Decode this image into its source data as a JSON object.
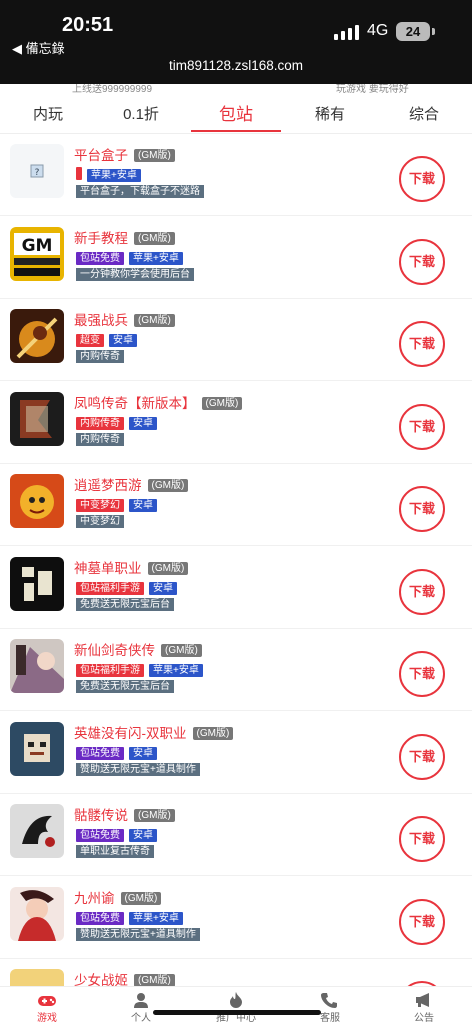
{
  "status": {
    "time": "20:51",
    "back": "◀ 備忘錄",
    "network": "4G",
    "battery": "24"
  },
  "browser": {
    "url": "tim891128.zsl168.com"
  },
  "ghost": {
    "left": "上线送999999999",
    "right": "玩游戏 要玩得好"
  },
  "tabs": [
    {
      "label": "内玩"
    },
    {
      "label": "0.1折"
    },
    {
      "label": "包站"
    },
    {
      "label": "稀有"
    },
    {
      "label": "综合"
    }
  ],
  "download_label": "下载",
  "colors": {
    "accent": "#e8343d",
    "tag_red": "#e8343d",
    "tag_blue": "#2c55c9",
    "tag_purple": "#6a2ac4",
    "tag_dark": "#5b6f80"
  },
  "games": [
    {
      "name": "平台盒子",
      "gm": "(GM版)",
      "tags": [
        {
          "text": "",
          "color": "red"
        },
        {
          "text": "苹果+安卓",
          "color": "blue"
        }
      ],
      "desc": "平台盒子，下载盒子不迷路",
      "icon": "question-box-icon"
    },
    {
      "name": "新手教程",
      "gm": "(GM版)",
      "tags": [
        {
          "text": "包站免费",
          "color": "purple"
        },
        {
          "text": "苹果+安卓",
          "color": "blue"
        }
      ],
      "desc": "一分钟教你学会使用后台",
      "icon": "gm-tutorial-icon"
    },
    {
      "name": "最强战兵",
      "gm": "(GM版)",
      "tags": [
        {
          "text": "超变",
          "color": "red"
        },
        {
          "text": "安卓",
          "color": "blue"
        }
      ],
      "desc": "内购传奇",
      "icon": "warrior-icon"
    },
    {
      "name": "凤鸣传奇【新版本】",
      "gm": "(GM版)",
      "tags": [
        {
          "text": "内购传奇",
          "color": "red"
        },
        {
          "text": "安卓",
          "color": "blue"
        }
      ],
      "desc": "内购传奇",
      "icon": "dragon-slayer-icon"
    },
    {
      "name": "逍遥梦西游",
      "gm": "(GM版)",
      "tags": [
        {
          "text": "中变梦幻",
          "color": "red"
        },
        {
          "text": "安卓",
          "color": "blue"
        }
      ],
      "desc": "中变梦幻",
      "icon": "journey-west-icon"
    },
    {
      "name": "神墓单职业",
      "gm": "(GM版)",
      "tags": [
        {
          "text": "包站福利手游",
          "color": "red"
        },
        {
          "text": "安卓",
          "color": "blue"
        }
      ],
      "desc": "免费送无限元宝后台",
      "icon": "shenmu-icon"
    },
    {
      "name": "新仙剑奇侠传",
      "gm": "(GM版)",
      "tags": [
        {
          "text": "包站福利手游",
          "color": "red"
        },
        {
          "text": "苹果+安卓",
          "color": "blue"
        }
      ],
      "desc": "免费送无限元宝后台",
      "icon": "xianjian-icon"
    },
    {
      "name": "英雄没有闪-双职业",
      "gm": "(GM版)",
      "tags": [
        {
          "text": "包站免费",
          "color": "purple"
        },
        {
          "text": "安卓",
          "color": "blue"
        }
      ],
      "desc": "赞助送无限元宝+道具制作",
      "icon": "hero-icon"
    },
    {
      "name": "骷髅传说",
      "gm": "(GM版)",
      "tags": [
        {
          "text": "包站免费",
          "color": "purple"
        },
        {
          "text": "安卓",
          "color": "blue"
        }
      ],
      "desc": "单职业复古传奇",
      "icon": "skull-dragon-icon"
    },
    {
      "name": "九州谕",
      "gm": "(GM版)",
      "tags": [
        {
          "text": "包站免费",
          "color": "purple"
        },
        {
          "text": "苹果+安卓",
          "color": "blue"
        }
      ],
      "desc": "赞助送无限元宝+道具制作",
      "icon": "jiuzhou-icon"
    },
    {
      "name": "少女战姬",
      "gm": "(GM版)",
      "tags": [],
      "desc": "",
      "icon": "girl-warrior-icon"
    }
  ],
  "bottom_nav": [
    {
      "label": "游戏",
      "icon": "gamepad-icon"
    },
    {
      "label": "个人",
      "icon": "person-icon"
    },
    {
      "label": "推广中心",
      "icon": "fire-icon"
    },
    {
      "label": "客服",
      "icon": "phone-icon"
    },
    {
      "label": "公告",
      "icon": "megaphone-icon"
    }
  ]
}
